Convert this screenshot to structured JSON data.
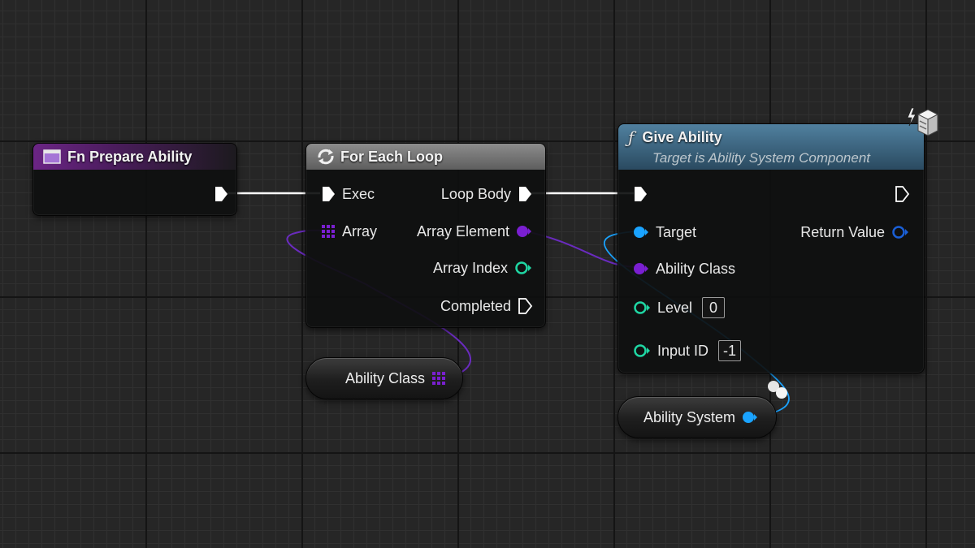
{
  "nodes": {
    "fn_prepare": {
      "title": "Fn Prepare Ability"
    },
    "for_each": {
      "title": "For Each Loop",
      "inputs": {
        "exec": "Exec",
        "array": "Array"
      },
      "outputs": {
        "loop_body": "Loop Body",
        "array_element": "Array Element",
        "array_index": "Array Index",
        "completed": "Completed"
      }
    },
    "give_ability": {
      "title": "Give Ability",
      "subtitle": "Target is Ability System Component",
      "inputs": {
        "target": "Target",
        "ability_class": "Ability Class",
        "level": "Level",
        "level_value": "0",
        "input_id": "Input ID",
        "input_id_value": "-1"
      },
      "outputs": {
        "return_value": "Return Value"
      }
    },
    "var_ability_class": {
      "label": "Ability Class"
    },
    "var_ability_system": {
      "label": "Ability System"
    }
  },
  "colors": {
    "exec": "#ffffff",
    "object_ref": "#1aa3ff",
    "class_ref": "#7a1fd1",
    "integer": "#1fd6a3",
    "header_function": "#50809f",
    "header_event": "#6b2585",
    "header_macro": "#8c8c8c"
  },
  "icons": {
    "fn_prepare": "function-graph-icon",
    "for_each": "loop-macro-icon",
    "give_ability": "function-f-icon",
    "corner": "server-authority-icon"
  }
}
